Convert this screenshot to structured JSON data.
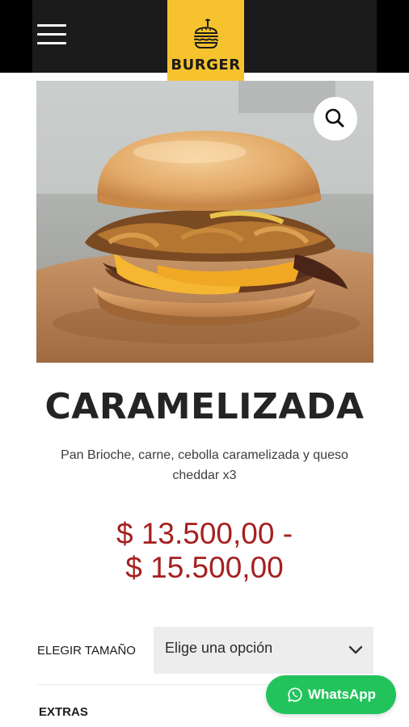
{
  "header": {
    "menu_icon": "hamburger-menu-icon",
    "logo_text": "BURGER",
    "logo_icon": "burger-icon",
    "colors": {
      "bar": "#1b1b1b",
      "logo_tag": "#f6c22d"
    }
  },
  "product": {
    "image_label": "caramelized onion cheeseburger photo",
    "zoom_icon": "magnifier-icon",
    "name": "CARAMELIZADA",
    "description": "Pan Brioche, carne, cebolla caramelizada y queso cheddar x3",
    "price_line1": "$ 13.500,00 -",
    "price_line2": "$ 15.500,00",
    "price_color": "#a52020"
  },
  "options": {
    "size_label": "ELEGIR TAMAÑO",
    "size_select": "Elige una opción",
    "extras_label": "EXTRAS"
  },
  "whatsapp": {
    "label": "WhatsApp",
    "icon": "whatsapp-icon",
    "color": "#23c35c"
  }
}
